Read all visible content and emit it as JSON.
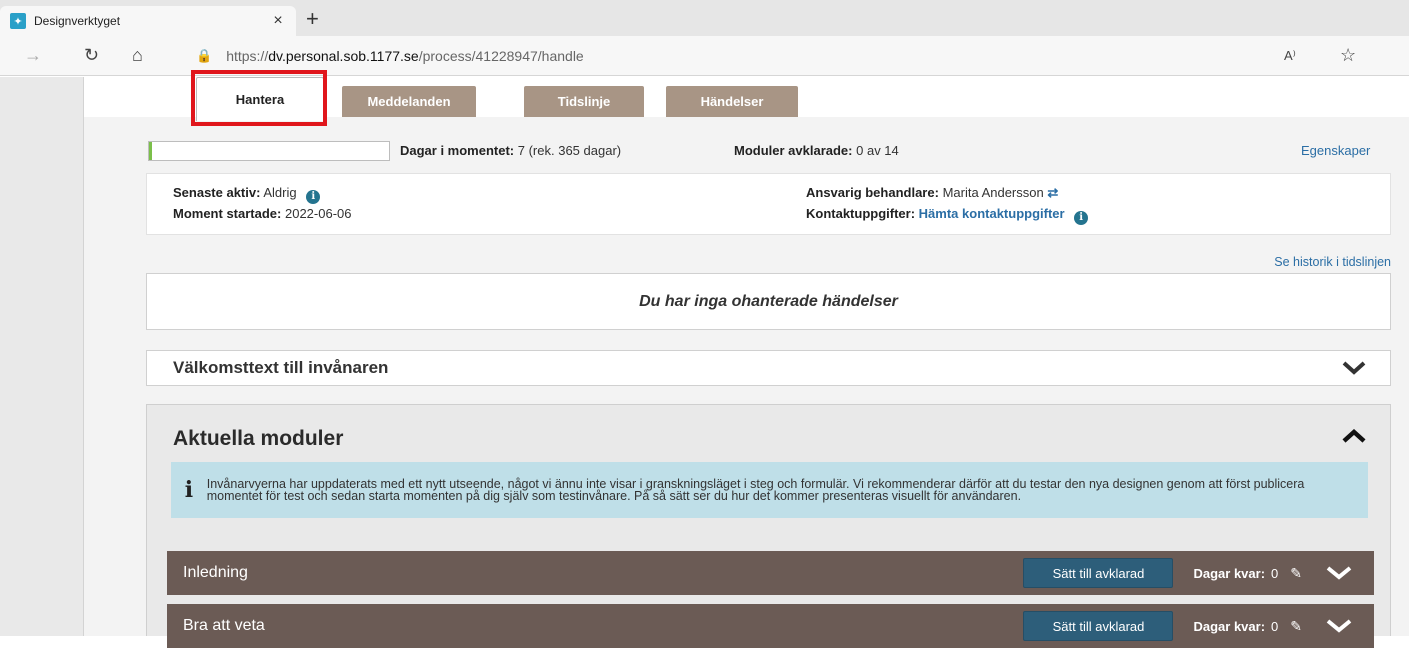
{
  "browser": {
    "tab_title": "Designverktyget",
    "tab_close": "×",
    "new_tab": "+",
    "url_prefix": "https://",
    "url_host": "dv.personal.sob.1177.se",
    "url_path": "/process/41228947/handle",
    "read_aloud": "A⁾",
    "favorite": "☆"
  },
  "tabs": {
    "hantera": "Hantera",
    "meddelanden": "Meddelanden",
    "tidslinje": "Tidslinje",
    "handelser": "Händelser"
  },
  "status": {
    "progress_fraction": 0.0,
    "dagar_label": "Dagar i momentet:",
    "dagar_value": "7 (rek. 365 dagar)",
    "moduler_label": "Moduler avklarade:",
    "moduler_value": "0 av 14",
    "egenskaper": "Egenskaper"
  },
  "info": {
    "senaste_label": "Senaste aktiv:",
    "senaste_value": "Aldrig",
    "moment_label": "Moment startade:",
    "moment_value": "2022-06-06",
    "ansvarig_label": "Ansvarig behandlare:",
    "ansvarig_value": "Marita Andersson",
    "kontakt_label": "Kontaktuppgifter:",
    "kontakt_link": "Hämta kontaktuppgifter"
  },
  "history_link": "Se historik i tidslinjen",
  "events_message": "Du har inga ohanterade händelser",
  "welcome_title": "Välkomsttext till invånaren",
  "modules": {
    "title": "Aktuella moduler",
    "notice": "Invånarvyerna har uppdaterats med ett nytt utseende, något vi ännu inte visar i granskningsläget i steg och formulär. Vi rekommenderar därför att du testar den nya designen genom att först publicera momentet för test och sedan starta momenten på dig själv som testinvånare. På så sätt ser du hur det kommer presenteras visuellt för användaren.",
    "rows": [
      {
        "title": "Inledning",
        "button": "Sätt till avklarad",
        "days_label": "Dagar kvar:",
        "days_value": "0"
      },
      {
        "title": "Bra att veta",
        "button": "Sätt till avklarad",
        "days_label": "Dagar kvar:",
        "days_value": "0"
      }
    ]
  },
  "colors": {
    "tab_bg": "#a89585",
    "module_row_bg": "#6b5b55",
    "button_bg": "#2d5e7a",
    "notice_bg": "#bfdfe8",
    "link": "#2b6ea5",
    "highlight": "#e0161c"
  }
}
